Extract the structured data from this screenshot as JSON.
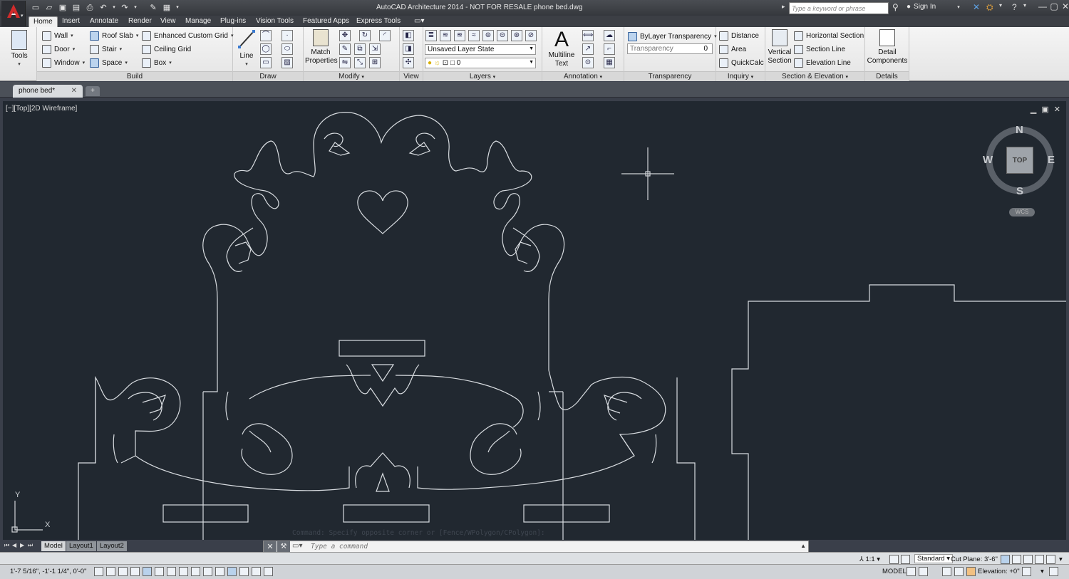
{
  "window": {
    "title": "AutoCAD Architecture 2014 - NOT FOR RESALE    phone bed.dwg",
    "search_placeholder": "Type a keyword or phrase",
    "sign_in": "Sign In"
  },
  "ribbon_tabs": [
    {
      "label": "Home",
      "active": true
    },
    {
      "label": "Insert"
    },
    {
      "label": "Annotate"
    },
    {
      "label": "Render"
    },
    {
      "label": "View"
    },
    {
      "label": "Manage"
    },
    {
      "label": "Plug-ins"
    },
    {
      "label": "Vision Tools"
    },
    {
      "label": "Featured Apps"
    },
    {
      "label": "Express Tools"
    }
  ],
  "ribbon": {
    "tools": {
      "label": "Tools"
    },
    "build": {
      "title": "Build",
      "wall": "Wall",
      "door": "Door",
      "window": "Window",
      "roof_slab": "Roof Slab",
      "stair": "Stair",
      "space": "Space",
      "enhanced_grid": "Enhanced Custom Grid",
      "ceiling_grid": "Ceiling Grid",
      "box": "Box"
    },
    "draw": {
      "title": "Draw",
      "line": "Line"
    },
    "modify": {
      "title": "Modify",
      "match_properties_1": "Match",
      "match_properties_2": "Properties"
    },
    "view": {
      "title": "View"
    },
    "layers": {
      "title": "Layers",
      "layer_state": "Unsaved Layer State",
      "current_layer": "0"
    },
    "annotation": {
      "title": "Annotation",
      "mtext_1": "Multiline",
      "mtext_2": "Text"
    },
    "transparency": {
      "title": "Transparency",
      "bylayer": "ByLayer Transparency",
      "field_label": "Transparency",
      "value": "0"
    },
    "inquiry": {
      "title": "Inquiry",
      "distance": "Distance",
      "area": "Area",
      "quickcalc": "QuickCalc"
    },
    "section": {
      "title": "Section & Elevation",
      "vertical_1": "Vertical",
      "vertical_2": "Section",
      "horizontal": "Horizontal Section",
      "section_line": "Section Line",
      "elevation_line": "Elevation Line"
    },
    "details": {
      "title": "Details",
      "detail_1": "Detail",
      "detail_2": "Components"
    }
  },
  "file_tab": {
    "name": "phone bed*"
  },
  "viewport": {
    "label": "[−][Top][2D Wireframe]",
    "viewcube": {
      "n": "N",
      "s": "S",
      "e": "E",
      "w": "W",
      "top": "TOP",
      "wcs": "WCS"
    },
    "ucs": {
      "x": "X",
      "y": "Y"
    }
  },
  "command": {
    "history": "Command: Specify opposite corner or [Fence/WPolygon/CPolygon]:",
    "placeholder": "Type a command"
  },
  "layout_tabs": [
    {
      "label": "Model",
      "active": true
    },
    {
      "label": "Layout1"
    },
    {
      "label": "Layout2"
    }
  ],
  "status": {
    "annotation_scale": "1:1",
    "style": "Standard",
    "cut_plane": "Cut Plane: 3'-6\"",
    "coordinates": "1'-7 5/16\", -1'-1 1/4\", 0'-0\"",
    "model": "MODEL",
    "elevation": "Elevation: +0\""
  },
  "colors": {
    "canvas": "#212830",
    "geometry": "#d8dce0",
    "ribbon": "#ececec"
  }
}
